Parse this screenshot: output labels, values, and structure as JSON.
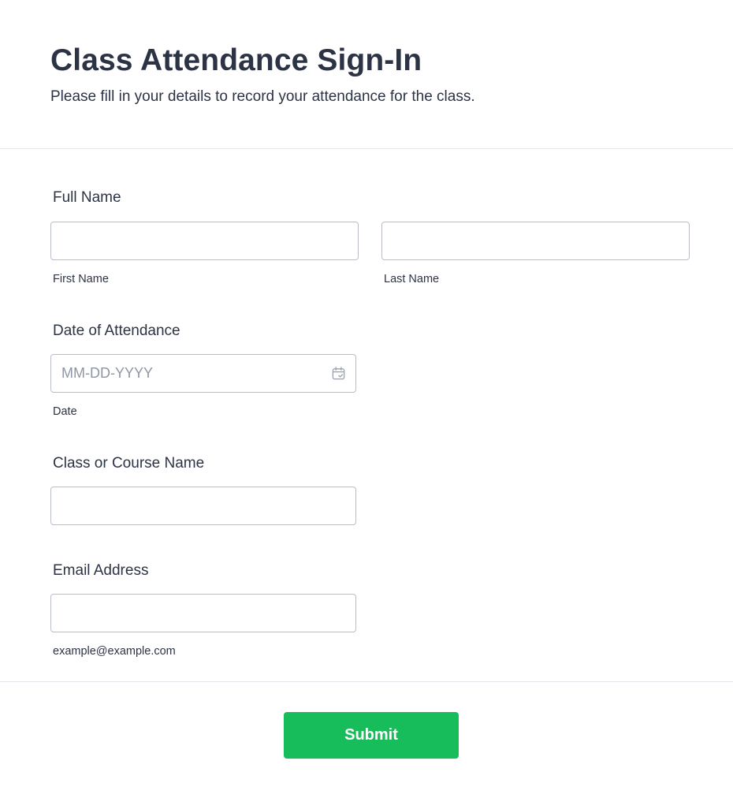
{
  "form": {
    "title": "Class Attendance Sign-In",
    "subtitle": "Please fill in your details to record your attendance for the class."
  },
  "fields": {
    "full_name": {
      "label": "Full Name",
      "first_name_value": "",
      "first_name_sublabel": "First Name",
      "last_name_value": "",
      "last_name_sublabel": "Last Name"
    },
    "date": {
      "label": "Date of Attendance",
      "value": "",
      "placeholder": "MM-DD-YYYY",
      "sublabel": "Date",
      "icon": "calendar-icon"
    },
    "course": {
      "label": "Class or Course Name",
      "value": ""
    },
    "email": {
      "label": "Email Address",
      "value": "",
      "sublabel": "example@example.com"
    }
  },
  "submit": {
    "label": "Submit"
  },
  "colors": {
    "text": "#2c3345",
    "border": "#b8bdc9",
    "placeholder": "#8f96a3",
    "divider": "#e3e5ea",
    "submit_bg": "#18bd5b",
    "submit_text": "#ffffff"
  }
}
